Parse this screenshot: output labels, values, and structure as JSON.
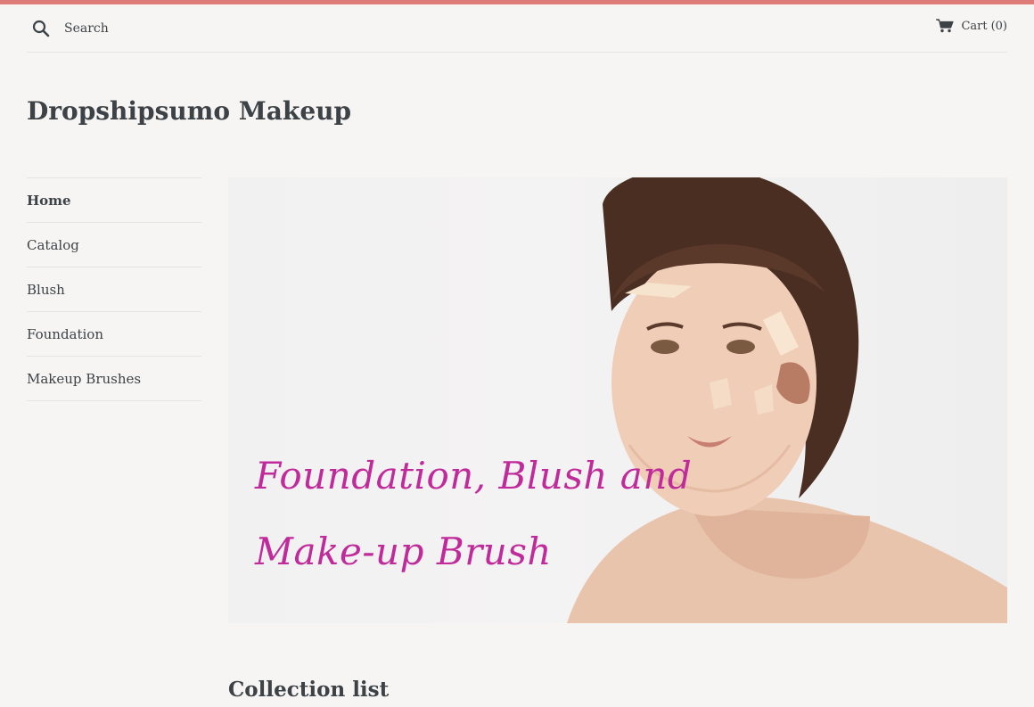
{
  "header": {
    "search_label": "Search",
    "search_placeholder": "Search",
    "cart_label": "Cart",
    "cart_count": "(0)"
  },
  "site": {
    "title": "Dropshipsumo Makeup"
  },
  "sidebar": {
    "items": [
      {
        "label": "Home"
      },
      {
        "label": "Catalog"
      },
      {
        "label": "Blush"
      },
      {
        "label": "Foundation"
      },
      {
        "label": "Makeup Brushes"
      }
    ]
  },
  "hero": {
    "line1": "Foundation, Blush and",
    "line2": "Make-up Brush"
  },
  "main": {
    "collection_title": "Collection list"
  },
  "colors": {
    "accent_bar": "#de7b78",
    "hero_text": "#c02a9a",
    "text": "#3d4246",
    "background": "#f6f5f4"
  }
}
